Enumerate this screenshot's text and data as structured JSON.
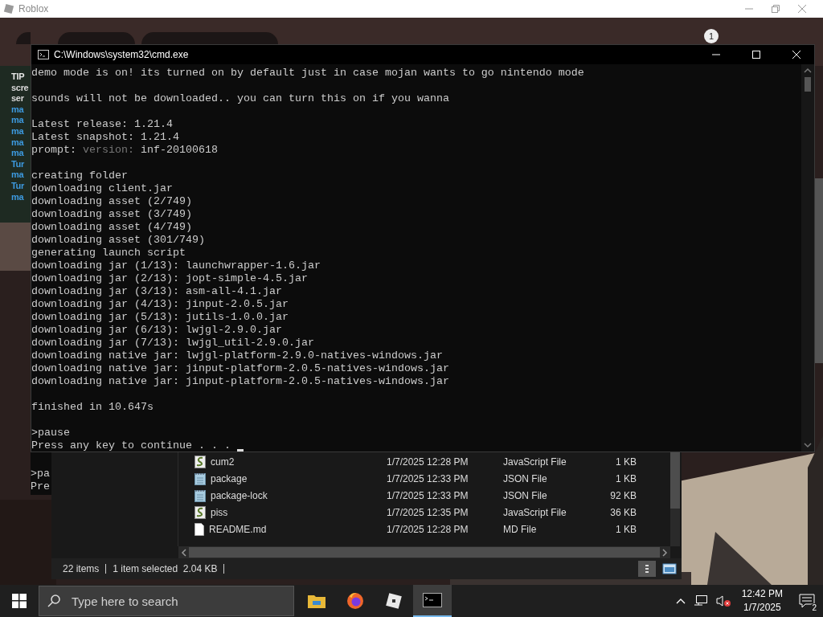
{
  "game_window": {
    "title": "Roblox",
    "notification_badge": "1",
    "chat_lines": [
      {
        "text": "TIP",
        "color": "#e8e8e8"
      },
      {
        "text": "scre",
        "color": "#d8d8d8"
      },
      {
        "text": "ser",
        "color": "#d8d8d8"
      },
      {
        "text": "ma",
        "color": "#3d9ae0"
      },
      {
        "text": "ma",
        "color": "#3d9ae0"
      },
      {
        "text": "ma",
        "color": "#3d9ae0"
      },
      {
        "text": "ma",
        "color": "#3d9ae0"
      },
      {
        "text": "ma",
        "color": "#3d9ae0"
      },
      {
        "text": "Tur",
        "color": "#3d9ae0"
      },
      {
        "text": "ma",
        "color": "#3d9ae0"
      },
      {
        "text": "Tur",
        "color": "#3d9ae0"
      },
      {
        "text": "ma",
        "color": "#3d9ae0"
      }
    ]
  },
  "console_behind": {
    "lines": [
      ">pa",
      "Pre"
    ]
  },
  "file_explorer": {
    "rows": [
      {
        "kind": "script",
        "name": "cum2",
        "modified": "1/7/2025 12:28 PM",
        "type": "JavaScript File",
        "size": "1 KB",
        "selected": false
      },
      {
        "kind": "json",
        "name": "package",
        "modified": "1/7/2025 12:33 PM",
        "type": "JSON File",
        "size": "1 KB",
        "selected": false
      },
      {
        "kind": "json",
        "name": "package-lock",
        "modified": "1/7/2025 12:33 PM",
        "type": "JSON File",
        "size": "92 KB",
        "selected": false
      },
      {
        "kind": "script",
        "name": "piss",
        "modified": "1/7/2025 12:35 PM",
        "type": "JavaScript File",
        "size": "36 KB",
        "selected": false
      },
      {
        "kind": "text",
        "name": "README.md",
        "modified": "1/7/2025 12:28 PM",
        "type": "MD File",
        "size": "1 KB",
        "selected": false
      }
    ],
    "status": {
      "count": "22 items",
      "selection": "1 item selected  2.04 KB"
    }
  },
  "console": {
    "title": "C:\\Windows\\system32\\cmd.exe",
    "lines": [
      {
        "kind": "text",
        "text": "demo mode is on! its turned on by default just in case mojan wants to go nintendo mode"
      },
      {
        "kind": "blank"
      },
      {
        "kind": "text",
        "text": "sounds will not be downloaded.. you can turn this on if you wanna"
      },
      {
        "kind": "blank"
      },
      {
        "kind": "text",
        "text": "Latest release: 1.21.4"
      },
      {
        "kind": "text",
        "text": "Latest snapshot: 1.21.4"
      },
      {
        "kind": "prompt",
        "label": "prompt:",
        "hint": "version:",
        "value": "inf-20100618"
      },
      {
        "kind": "blank"
      },
      {
        "kind": "text",
        "text": "creating folder"
      },
      {
        "kind": "text",
        "text": "downloading client.jar"
      },
      {
        "kind": "text",
        "text": "downloading asset (2/749)"
      },
      {
        "kind": "text",
        "text": "downloading asset (3/749)"
      },
      {
        "kind": "text",
        "text": "downloading asset (4/749)"
      },
      {
        "kind": "text",
        "text": "downloading asset (301/749)"
      },
      {
        "kind": "text",
        "text": "generating launch script"
      },
      {
        "kind": "text",
        "text": "downloading jar (1/13): launchwrapper-1.6.jar"
      },
      {
        "kind": "text",
        "text": "downloading jar (2/13): jopt-simple-4.5.jar"
      },
      {
        "kind": "text",
        "text": "downloading jar (3/13): asm-all-4.1.jar"
      },
      {
        "kind": "text",
        "text": "downloading jar (4/13): jinput-2.0.5.jar"
      },
      {
        "kind": "text",
        "text": "downloading jar (5/13): jutils-1.0.0.jar"
      },
      {
        "kind": "text",
        "text": "downloading jar (6/13): lwjgl-2.9.0.jar"
      },
      {
        "kind": "text",
        "text": "downloading jar (7/13): lwjgl_util-2.9.0.jar"
      },
      {
        "kind": "text",
        "text": "downloading native jar: lwjgl-platform-2.9.0-natives-windows.jar"
      },
      {
        "kind": "text",
        "text": "downloading native jar: jinput-platform-2.0.5-natives-windows.jar"
      },
      {
        "kind": "text",
        "text": "downloading native jar: jinput-platform-2.0.5-natives-windows.jar"
      },
      {
        "kind": "blank"
      },
      {
        "kind": "text",
        "text": "finished in 10.647s"
      },
      {
        "kind": "blank"
      },
      {
        "kind": "text",
        "text": ">pause"
      },
      {
        "kind": "text",
        "text": "Press any key to continue . . .",
        "cursor": true
      }
    ]
  },
  "taskbar": {
    "search": {
      "placeholder": "Type here to search"
    },
    "apps": [
      {
        "kind": "explorer",
        "active": false
      },
      {
        "kind": "firefox",
        "active": false
      },
      {
        "kind": "roblox",
        "active": false
      },
      {
        "kind": "terminal",
        "active": true
      }
    ],
    "volume_muted": true,
    "clock": {
      "time": "12:42 PM",
      "date": "1/7/2025"
    },
    "notifications": "2"
  }
}
